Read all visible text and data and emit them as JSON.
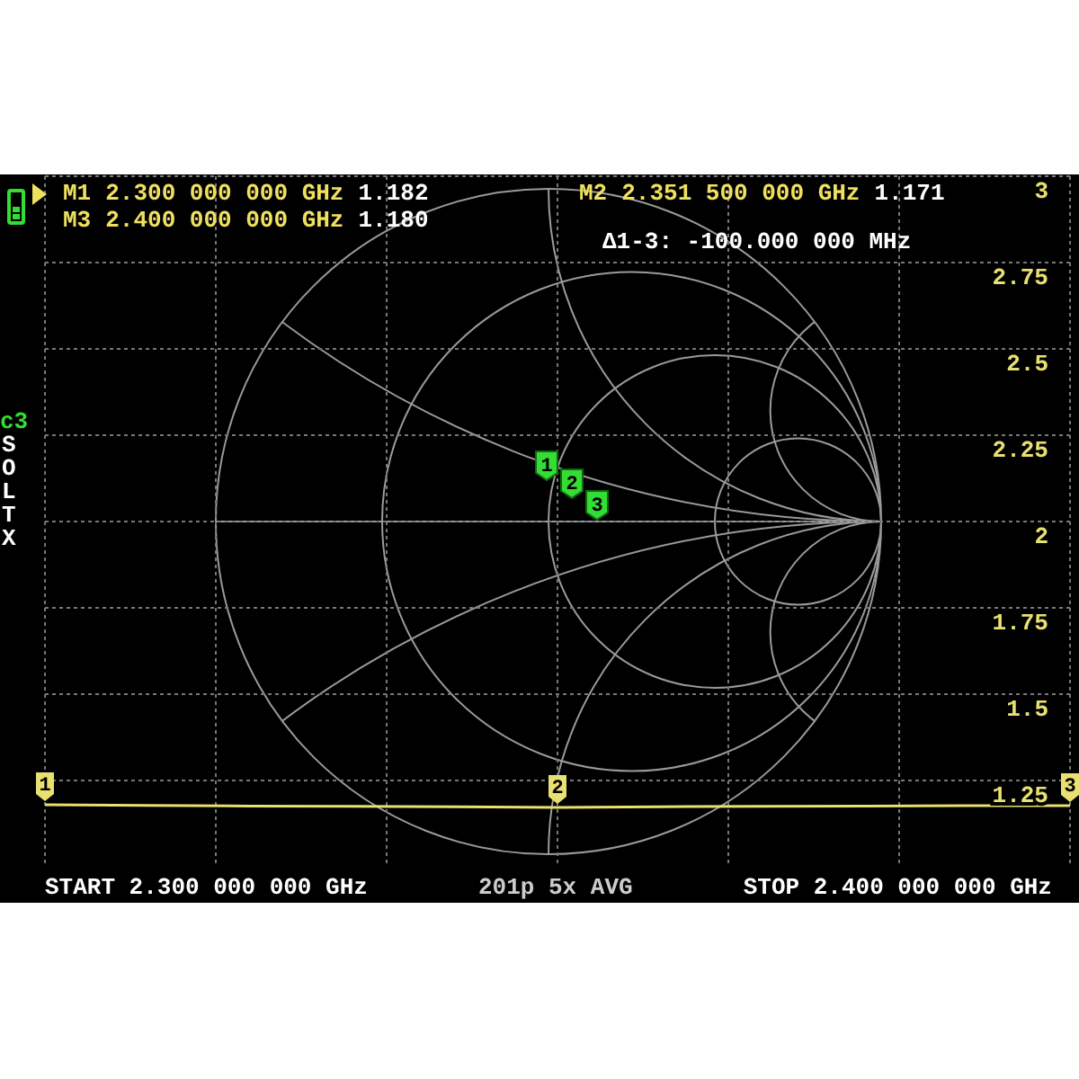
{
  "markers": [
    {
      "label": "M1",
      "frequency": "2.300 000 000 GHz",
      "value": "1.182",
      "selected": true
    },
    {
      "label": "M3",
      "frequency": "2.400 000 000 GHz",
      "value": "1.180",
      "selected": false
    },
    {
      "label": "M2",
      "frequency": "2.351 500 000 GHz",
      "value": "1.171",
      "selected": false
    }
  ],
  "delta": "Δ1-3: -100.000 000 MHz",
  "calibration": {
    "label": "c3",
    "flags": [
      "S",
      "O",
      "L",
      "T",
      "X"
    ]
  },
  "smith_markers": [
    "1",
    "2",
    "3"
  ],
  "trace_markers": [
    "1",
    "2",
    "3"
  ],
  "chart_data": {
    "type": "line",
    "grid": true,
    "ylim": [
      1,
      3
    ],
    "yticks": [
      1.25,
      1.5,
      1.75,
      2,
      2.25,
      2.5,
      2.75,
      3
    ],
    "series": [
      {
        "color": "#e8e070",
        "values": [
          1.18,
          1.178,
          1.176,
          1.175,
          1.174,
          1.172,
          1.174,
          1.175,
          1.176,
          1.177,
          1.177
        ]
      }
    ]
  },
  "footer": {
    "start": "START 2.300 000 000 GHz",
    "points": "201p 5x AVG",
    "stop": "STOP 2.400 000 000 GHz"
  }
}
